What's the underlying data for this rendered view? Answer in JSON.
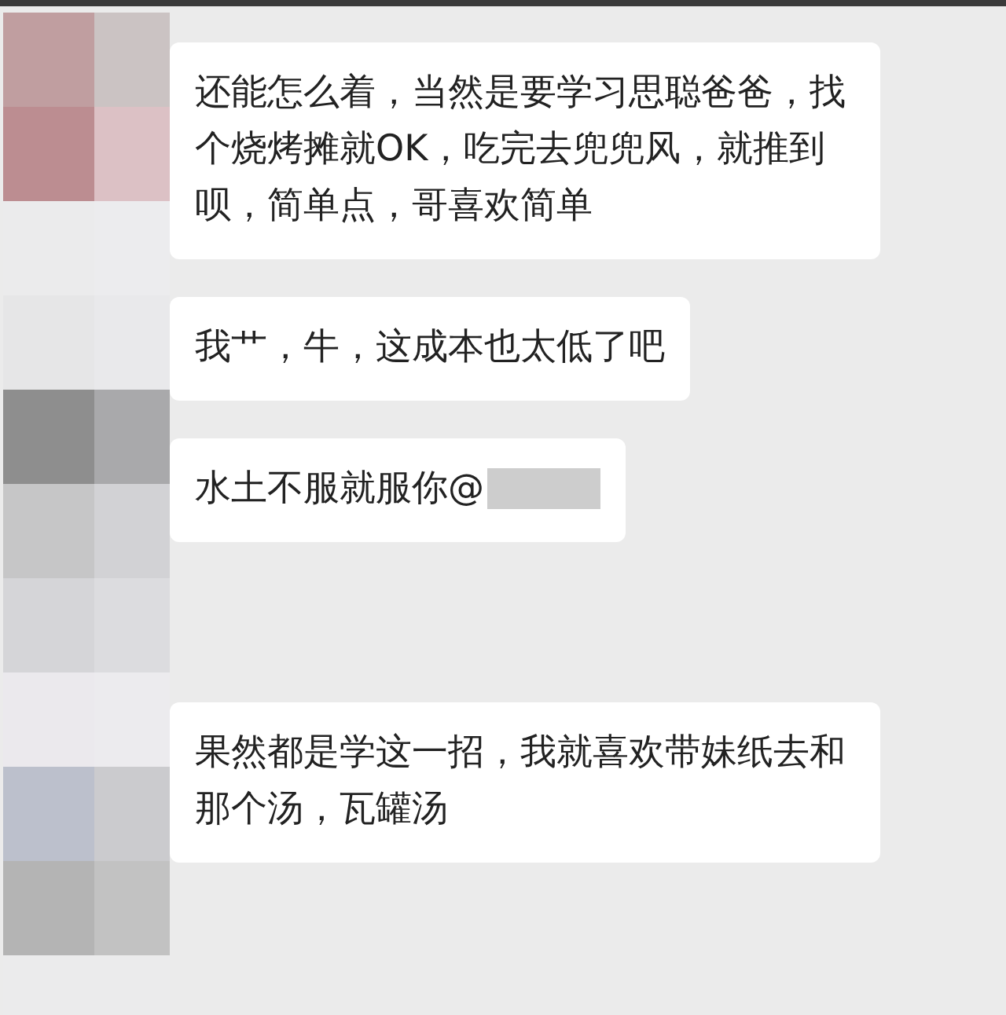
{
  "messages": [
    {
      "text": "还能怎么着，当然是要学习思聪爸爸，找个烧烤摊就OK，吃完去兜兜风，就推到呗，简单点，哥喜欢简单"
    },
    {
      "text": "我艹，牛，这成本也太低了吧"
    },
    {
      "text": "水土不服就服你@",
      "redacted_mention": true
    },
    {
      "text": "果然都是学这一招，我就喜欢带妹纸去和那个汤，瓦罐汤"
    }
  ]
}
